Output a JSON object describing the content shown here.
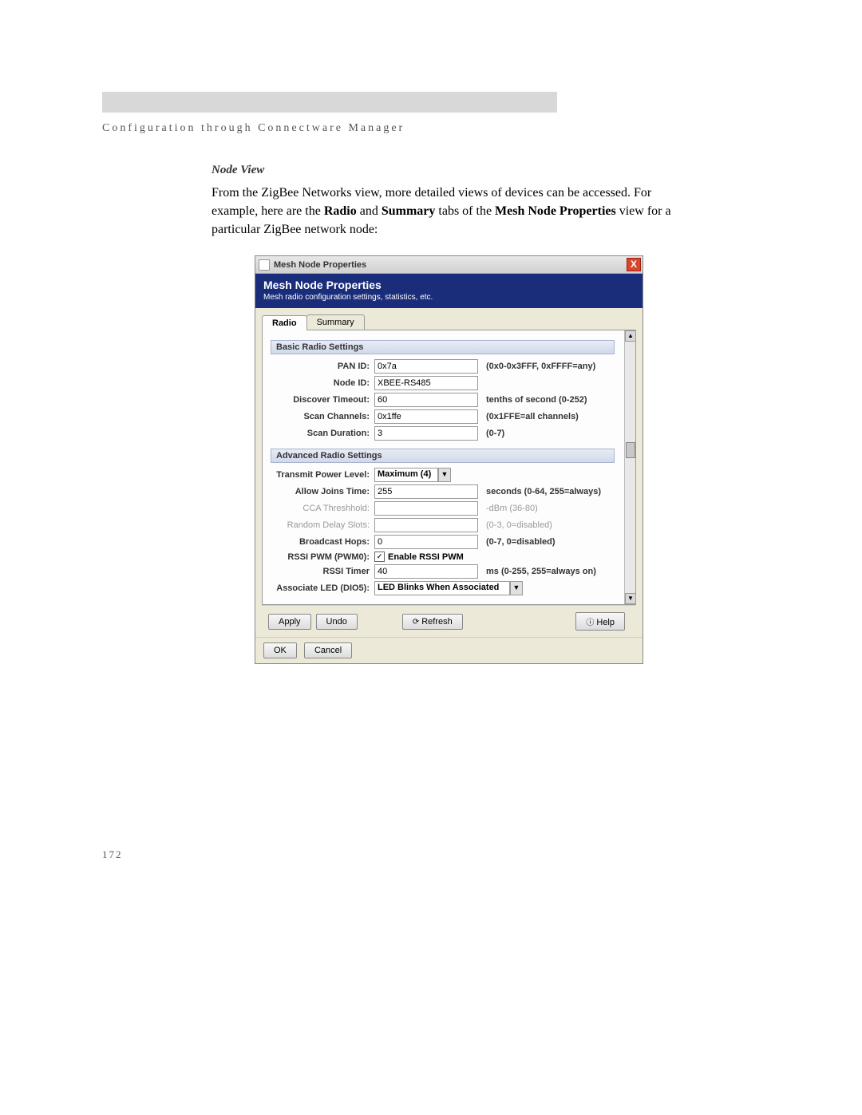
{
  "page": {
    "header": "Configuration through Connectware Manager",
    "section_title": "Node View",
    "body_part1": "From the ZigBee Networks view, more detailed views of devices can be accessed. For example, here are the ",
    "body_bold1": "Radio",
    "body_part2": " and ",
    "body_bold2": "Summary",
    "body_part3": " tabs of the ",
    "body_bold3": "Mesh Node Properties",
    "body_part4": " view for a particular ZigBee network node:",
    "page_number": "172"
  },
  "dialog": {
    "title": "Mesh Node Properties",
    "close": "X",
    "header_title": "Mesh Node Properties",
    "header_sub": "Mesh radio configuration settings, statistics, etc.",
    "tabs": {
      "radio": "Radio",
      "summary": "Summary"
    },
    "sections": {
      "basic": "Basic Radio Settings",
      "advanced": "Advanced Radio Settings"
    },
    "fields": {
      "pan_id": {
        "label": "PAN ID:",
        "value": "0x7a",
        "hint": "(0x0-0x3FFF, 0xFFFF=any)"
      },
      "node_id": {
        "label": "Node ID:",
        "value": "XBEE-RS485"
      },
      "discover_timeout": {
        "label": "Discover Timeout:",
        "value": "60",
        "hint": "tenths of second (0-252)"
      },
      "scan_channels": {
        "label": "Scan Channels:",
        "value": "0x1ffe",
        "hint": "(0x1FFE=all channels)"
      },
      "scan_duration": {
        "label": "Scan Duration:",
        "value": "3",
        "hint": "(0-7)"
      },
      "tx_power": {
        "label": "Transmit Power Level:",
        "value": "Maximum (4)"
      },
      "allow_joins": {
        "label": "Allow Joins Time:",
        "value": "255",
        "hint": "seconds (0-64, 255=always)"
      },
      "cca": {
        "label": "CCA Threshhold:",
        "value": "",
        "hint": "-dBm (36-80)"
      },
      "random_delay": {
        "label": "Random Delay Slots:",
        "value": "",
        "hint": "(0-3, 0=disabled)"
      },
      "broadcast_hops": {
        "label": "Broadcast Hops:",
        "value": "0",
        "hint": "(0-7, 0=disabled)"
      },
      "rssi_pwm": {
        "label": "RSSI PWM (PWM0):",
        "checkbox": "Enable RSSI PWM"
      },
      "rssi_timer": {
        "label": "RSSI Timer",
        "value": "40",
        "hint": "ms (0-255, 255=always on)"
      },
      "assoc_led": {
        "label": "Associate LED (DIO5):",
        "value": "LED Blinks When Associated"
      }
    },
    "buttons": {
      "apply": "Apply",
      "undo": "Undo",
      "refresh": "Refresh",
      "help": "Help",
      "ok": "OK",
      "cancel": "Cancel"
    }
  }
}
